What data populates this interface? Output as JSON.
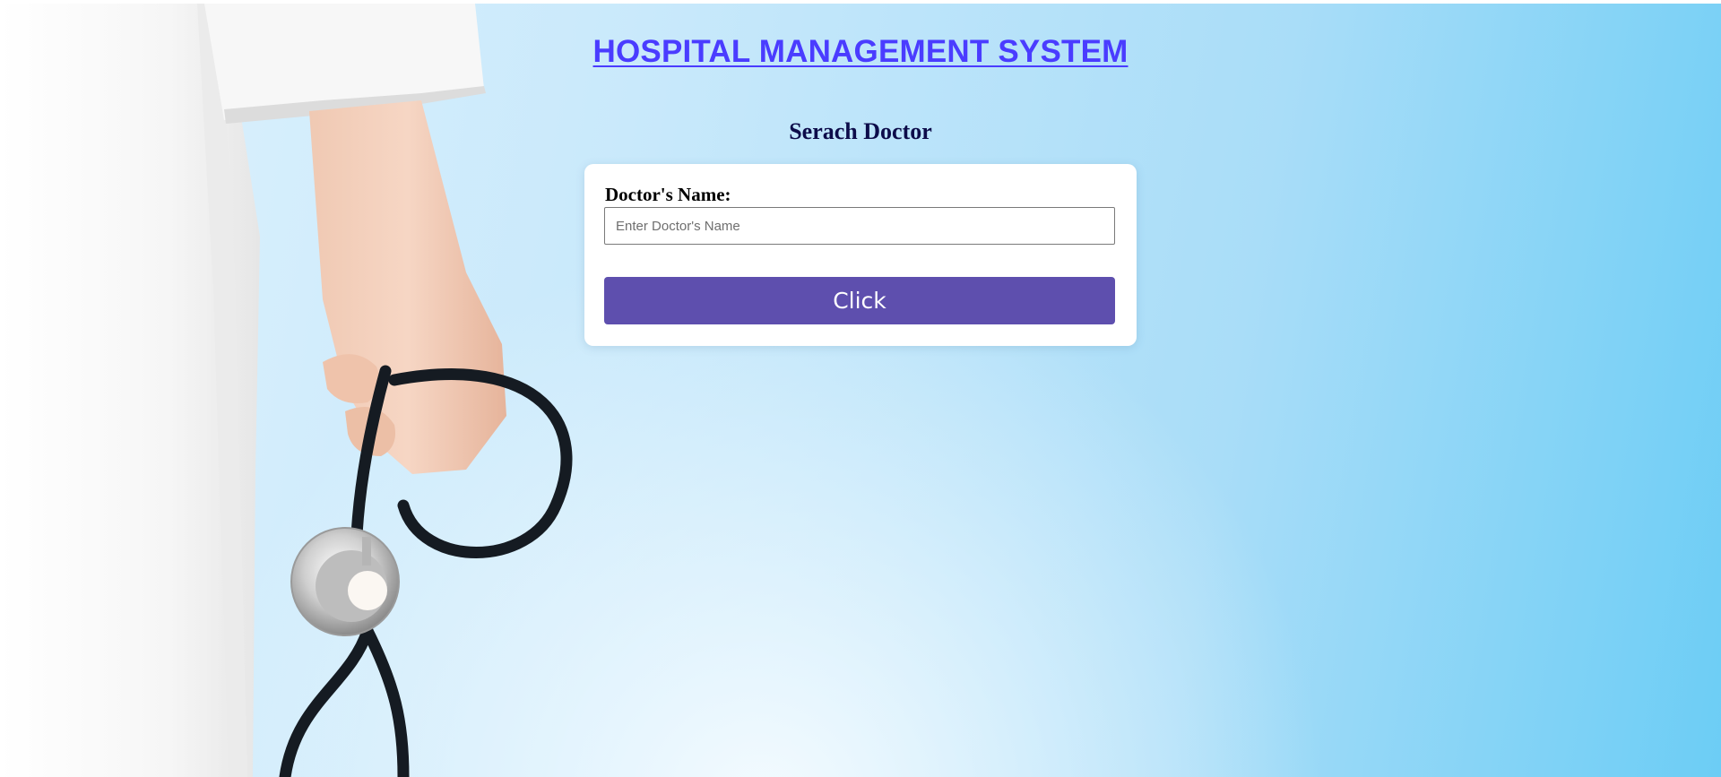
{
  "header": {
    "title": "HOSPITAL MANAGEMENT SYSTEM"
  },
  "search_form": {
    "heading": "Serach Doctor",
    "name_label": "Doctor's Name:",
    "name_placeholder": "Enter Doctor's Name",
    "name_value": "",
    "submit_label": "Click"
  },
  "colors": {
    "title_link": "#4a3cff",
    "heading": "#0d0c4a",
    "button": "#5e4fae",
    "background_light": "#dff2fd",
    "background_accent": "#6ccdf5"
  },
  "icons": {
    "hero": "doctor-with-stethoscope-photo"
  }
}
